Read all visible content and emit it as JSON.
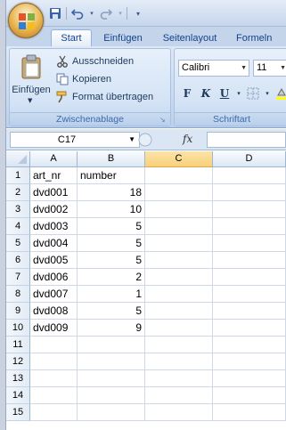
{
  "quick_access": {
    "save": "save-icon",
    "undo": "undo-icon",
    "redo": "redo-icon",
    "customize": "customize-qat-icon"
  },
  "tabs": [
    "Start",
    "Einfügen",
    "Seitenlayout",
    "Formeln"
  ],
  "active_tab": "Start",
  "clipboard": {
    "paste_label": "Einfügen",
    "cut_label": "Ausschneiden",
    "copy_label": "Kopieren",
    "format_painter_label": "Format übertragen",
    "group_label": "Zwischenablage"
  },
  "font": {
    "family": "Calibri",
    "size": "11",
    "bold": "F",
    "italic": "K",
    "underline": "U",
    "group_label": "Schriftart"
  },
  "formula_bar": {
    "name_box": "C17",
    "fx_label": "fx",
    "content": ""
  },
  "columns": [
    "A",
    "B",
    "C",
    "D"
  ],
  "selected_column": "C",
  "rows": [
    {
      "n": "1",
      "a": "art_nr",
      "b": "number"
    },
    {
      "n": "2",
      "a": "dvd001",
      "b": "18"
    },
    {
      "n": "3",
      "a": "dvd002",
      "b": "10"
    },
    {
      "n": "4",
      "a": "dvd003",
      "b": "5"
    },
    {
      "n": "5",
      "a": "dvd004",
      "b": "5"
    },
    {
      "n": "6",
      "a": "dvd005",
      "b": "5"
    },
    {
      "n": "7",
      "a": "dvd006",
      "b": "2"
    },
    {
      "n": "8",
      "a": "dvd007",
      "b": "1"
    },
    {
      "n": "9",
      "a": "dvd008",
      "b": "5"
    },
    {
      "n": "10",
      "a": "dvd009",
      "b": "9"
    },
    {
      "n": "11",
      "a": "",
      "b": ""
    },
    {
      "n": "12",
      "a": "",
      "b": ""
    },
    {
      "n": "13",
      "a": "",
      "b": ""
    },
    {
      "n": "14",
      "a": "",
      "b": ""
    },
    {
      "n": "15",
      "a": "",
      "b": ""
    }
  ],
  "colors": {
    "ribbon": "#c9dbf1",
    "selected_header": "#f8d07a",
    "gridline": "#d0d7e5"
  }
}
